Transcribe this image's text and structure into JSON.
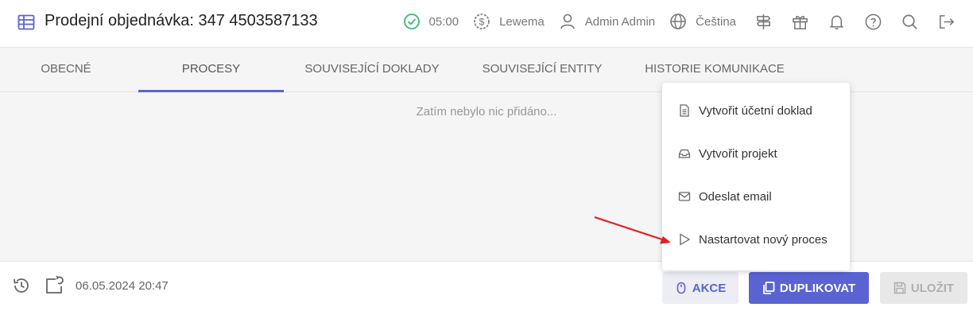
{
  "header": {
    "title": "Prodejní objednávka: 347 4503587133",
    "timer": "05:00",
    "company": "Lewema",
    "user": "Admin Admin",
    "language": "Čeština",
    "icons": [
      "table-icon",
      "check-circle-icon",
      "dollar-circle-icon",
      "user-icon",
      "globe-icon",
      "signpost-icon",
      "gift-icon",
      "bell-icon",
      "help-icon",
      "search-icon",
      "logout-icon"
    ]
  },
  "tabs": [
    {
      "label": "OBECNÉ"
    },
    {
      "label": "PROCESY",
      "active": true
    },
    {
      "label": "SOUVISEJÍCÍ DOKLADY"
    },
    {
      "label": "SOUVISEJÍCÍ ENTITY"
    },
    {
      "label": "HISTORIE KOMUNIKACE"
    }
  ],
  "main": {
    "empty_text": "Zatím nebylo nic přidáno..."
  },
  "menu": {
    "items": [
      {
        "label": "Vytvořit účetní doklad",
        "icon": "document-icon"
      },
      {
        "label": "Vytvořit projekt",
        "icon": "inbox-icon"
      },
      {
        "label": "Odeslat email",
        "icon": "mail-icon"
      },
      {
        "label": "Nastartovat nový proces",
        "icon": "play-icon"
      }
    ]
  },
  "footer": {
    "date": "06.05.2024 20:47",
    "akce_label": "AKCE",
    "duplicate_label": "DUPLIKOVAT",
    "save_label": "ULOŽIT"
  },
  "colors": {
    "accent": "#5b63d3",
    "success": "#3cb878",
    "arrow": "#e0201e"
  }
}
